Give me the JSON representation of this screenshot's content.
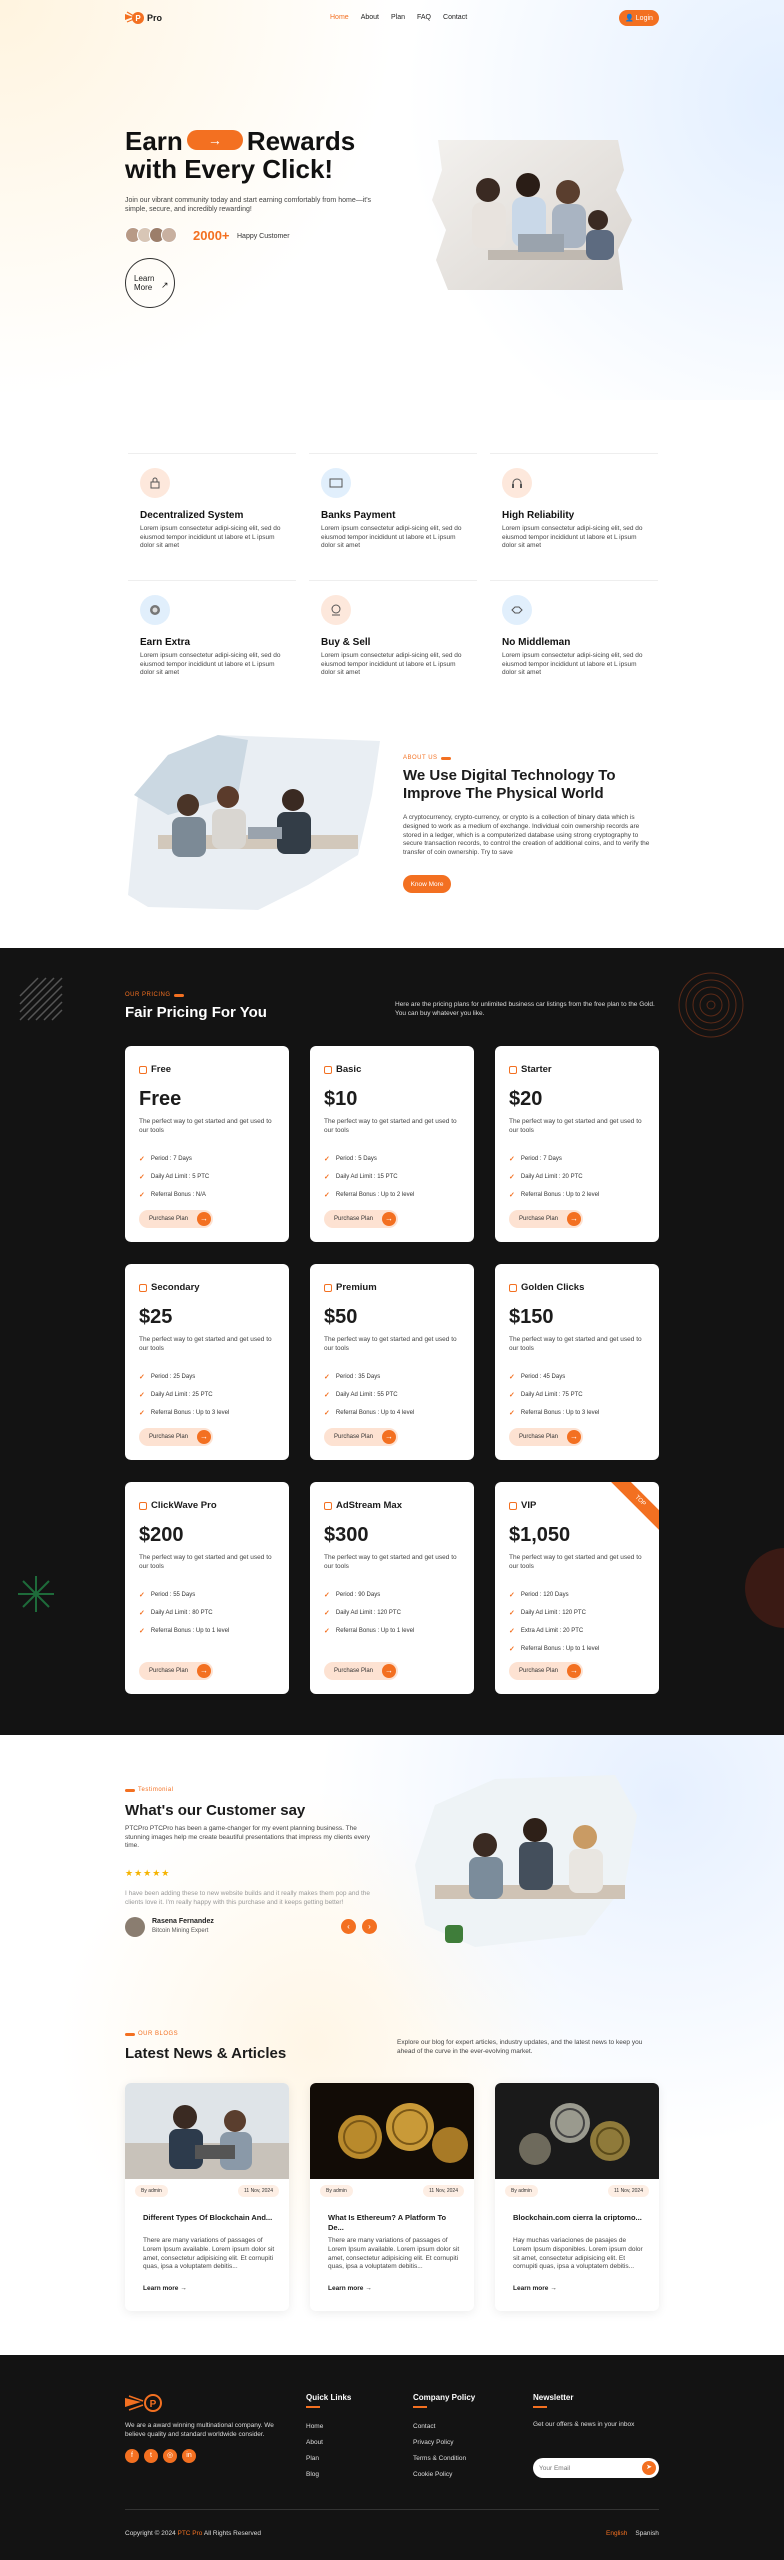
{
  "colors": {
    "accent": "#f37021",
    "dark": "#131313"
  },
  "nav": {
    "brand": "Pro",
    "links": [
      "Home",
      "About",
      "Plan",
      "FAQ",
      "Contact"
    ],
    "login": "Login"
  },
  "hero": {
    "title_a": "Earn",
    "title_b": "Rewards",
    "title_c": "with Every Click!",
    "desc": "Join our vibrant community today and start earning comfortably from home—it's simple, secure, and incredibly rewarding!",
    "count": "2000+",
    "count_label": "Happy Customer",
    "learn": "Learn More"
  },
  "features": [
    {
      "icon": "lock-icon",
      "title": "Decentralized System",
      "desc": "Lorem ipsum consectetur adipi-sicing elit, sed do eiusmod tempor incididunt ut labore et L ipsum dolor sit amet"
    },
    {
      "icon": "bank-card-icon",
      "title": "Banks Payment",
      "desc": "Lorem ipsum consectetur adipi-sicing elit, sed do eiusmod tempor incididunt ut labore et L ipsum dolor sit amet"
    },
    {
      "icon": "headset-icon",
      "title": "High Reliability",
      "desc": "Lorem ipsum consectetur adipi-sicing elit, sed do eiusmod tempor incididunt ut labore et L ipsum dolor sit amet"
    },
    {
      "icon": "coin-icon",
      "title": "Earn Extra",
      "desc": "Lorem ipsum consectetur adipi-sicing elit, sed do eiusmod tempor incididunt ut labore et L ipsum dolor sit amet"
    },
    {
      "icon": "exchange-icon",
      "title": "Buy & Sell",
      "desc": "Lorem ipsum consectetur adipi-sicing elit, sed do eiusmod tempor incididunt ut labore et L ipsum dolor sit amet"
    },
    {
      "icon": "handshake-icon",
      "title": "No Middleman",
      "desc": "Lorem ipsum consectetur adipi-sicing elit, sed do eiusmod tempor incididunt ut labore et L ipsum dolor sit amet"
    }
  ],
  "about": {
    "tag": "ABOUT US",
    "title": "We Use Digital Technology To Improve The Physical World",
    "desc": "A cryptocurrency, crypto-currency, or crypto is a collection of binary data which is designed to work as a medium of exchange. Individual coin ownership records are stored in a ledger, which is a computerized database using strong cryptography to secure transaction records, to control the creation of additional coins, and to verify the transfer of coin ownership. Try to save",
    "btn": "Know More"
  },
  "pricing": {
    "tag": "OUR PRICING",
    "title": "Fair Pricing For You",
    "intro": "Here are the pricing plans for unlimited business car listings from the free plan to the Gold. You can buy whatever you like.",
    "desc": "The perfect way to get started and get used to our tools",
    "btn": "Purchase Plan",
    "ribbon": "TOP",
    "plans": [
      {
        "name": "Free",
        "price": "Free",
        "features": [
          "Period : 7 Days",
          "Daily Ad Limit : 5 PTC",
          "Referral Bonus : N/A"
        ]
      },
      {
        "name": "Basic",
        "price": "$10",
        "features": [
          "Period : 5 Days",
          "Daily Ad Limit : 15 PTC",
          "Referral Bonus : Up to 2 level"
        ]
      },
      {
        "name": "Starter",
        "price": "$20",
        "features": [
          "Period : 7 Days",
          "Daily Ad Limit : 20 PTC",
          "Referral Bonus : Up to 2 level"
        ]
      },
      {
        "name": "Secondary",
        "price": "$25",
        "features": [
          "Period : 25 Days",
          "Daily Ad Limit : 25 PTC",
          "Referral Bonus : Up to 3 level"
        ]
      },
      {
        "name": "Premium",
        "price": "$50",
        "features": [
          "Period : 35 Days",
          "Daily Ad Limit : 55 PTC",
          "Referral Bonus : Up to 4 level"
        ]
      },
      {
        "name": "Golden Clicks",
        "price": "$150",
        "features": [
          "Period : 45 Days",
          "Daily Ad Limit : 75 PTC",
          "Referral Bonus : Up to 3 level"
        ]
      },
      {
        "name": "ClickWave Pro",
        "price": "$200",
        "features": [
          "Period : 55 Days",
          "Daily Ad Limit : 80 PTC",
          "Referral Bonus : Up to 1 level"
        ]
      },
      {
        "name": "AdStream Max",
        "price": "$300",
        "features": [
          "Period : 90 Days",
          "Daily Ad Limit : 120 PTC",
          "Referral Bonus : Up to 1 level"
        ]
      },
      {
        "name": "VIP",
        "price": "$1,050",
        "features": [
          "Period : 120 Days",
          "Daily Ad Limit : 120 PTC",
          "Extra Ad Limit : 20 PTC",
          "Referral Bonus : Up to 1 level"
        ]
      }
    ]
  },
  "testimonial": {
    "tag": "Testimonial",
    "title": "What's our Customer say",
    "desc": "PTCPro PTCPro has been a game-changer for my event planning business. The stunning images help me create beautiful presentations that impress my clients every time.",
    "stars": "★★★★★",
    "quote": "I have been adding these to new website builds and it really makes them pop and the clients love it. I'm really happy with this purchase and it keeps getting better!",
    "name": "Rasena Fernandez",
    "role": "Bitcoin Mining Expert"
  },
  "blog": {
    "tag": "OUR BLOGS",
    "title": "Latest News & Articles",
    "intro": "Explore our blog for expert articles, industry updates, and the latest news to keep you ahead of the curve in the ever-evolving market.",
    "posts": [
      {
        "author": "By admin",
        "date": "11 Nov, 2024",
        "title": "Different Types Of Blockchain And...",
        "desc": "There are many variations of passages of Lorem Ipsum available. Lorem ipsum dolor sit amet, consectetur adipisicing elit. Et cornupiti quas, ipsa a voluptatem debitis...",
        "more": "Learn more"
      },
      {
        "author": "By admin",
        "date": "11 Nov, 2024",
        "title": "What Is Ethereum? A Platform To De...",
        "desc": "There are many variations of passages of Lorem Ipsum available. Lorem ipsum dolor sit amet, consectetur adipisicing elit. Et cornupiti quas, ipsa a voluptatem debitis...",
        "more": "Learn more"
      },
      {
        "author": "By admin",
        "date": "11 Nov, 2024",
        "title": "Blockchain.com cierra la criptomo...",
        "desc": "Hay muchas variaciones de pasajes de Lorem Ipsum disponibles. Lorem ipsum dolor sit amet, consectetur adipisicing elit. Et cornupiti quas, ipsa a voluptatem debitis...",
        "more": "Learn more"
      }
    ]
  },
  "footer": {
    "about": "We are a award winning multinational company. We believe quality and standard worldwide consider.",
    "quick_title": "Quick Links",
    "quick": [
      "Home",
      "About",
      "Plan",
      "Blog"
    ],
    "policy_title": "Company Policy",
    "policy": [
      "Contact",
      "Privacy Policy",
      "Terms & Condition",
      "Cookie Policy"
    ],
    "news_title": "Newsletter",
    "news_desc": "Get our offers & news in your inbox",
    "email_placeholder": "Your Email",
    "copy_a": "Copyright © 2024",
    "copy_brand": "PTC Pro",
    "copy_b": "All Rights Reserved",
    "lang_a": "English",
    "lang_b": "Spanish"
  }
}
